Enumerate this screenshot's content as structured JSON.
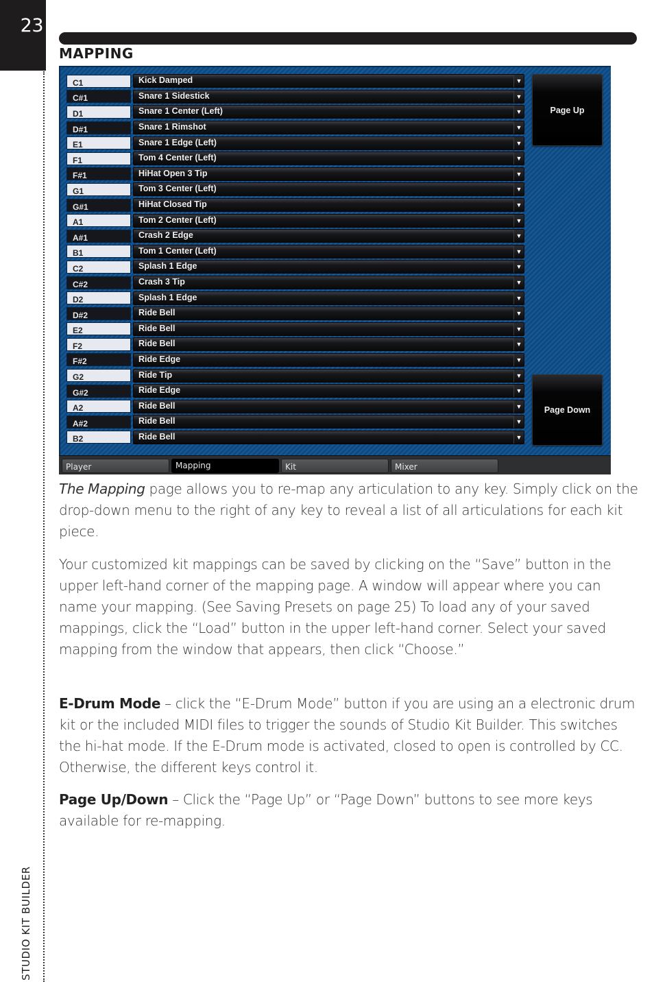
{
  "page": {
    "number": "23",
    "side_title": "STUDIO KIT BUILDER",
    "section_heading": "MAPPING"
  },
  "plugin": {
    "rows": [
      {
        "key": "C1",
        "type": "natural",
        "articulation": "Kick Damped"
      },
      {
        "key": "C#1",
        "type": "sharp",
        "articulation": "Snare 1 Sidestick"
      },
      {
        "key": "D1",
        "type": "natural",
        "articulation": "Snare 1 Center (Left)"
      },
      {
        "key": "D#1",
        "type": "sharp",
        "articulation": "Snare 1 Rimshot"
      },
      {
        "key": "E1",
        "type": "natural",
        "articulation": "Snare 1 Edge (Left)"
      },
      {
        "key": "F1",
        "type": "natural",
        "articulation": "Tom 4 Center (Left)"
      },
      {
        "key": "F#1",
        "type": "sharp",
        "articulation": "HiHat Open 3 Tip"
      },
      {
        "key": "G1",
        "type": "natural",
        "articulation": "Tom 3 Center (Left)"
      },
      {
        "key": "G#1",
        "type": "sharp",
        "articulation": "HiHat Closed Tip"
      },
      {
        "key": "A1",
        "type": "natural",
        "articulation": "Tom 2 Center (Left)"
      },
      {
        "key": "A#1",
        "type": "sharp",
        "articulation": "Crash 2 Edge"
      },
      {
        "key": "B1",
        "type": "natural",
        "articulation": "Tom 1 Center (Left)"
      },
      {
        "key": "C2",
        "type": "natural",
        "articulation": "Splash 1 Edge"
      },
      {
        "key": "C#2",
        "type": "sharp",
        "articulation": "Crash 3 Tip"
      },
      {
        "key": "D2",
        "type": "natural",
        "articulation": "Splash 1 Edge"
      },
      {
        "key": "D#2",
        "type": "sharp",
        "articulation": "Ride Bell"
      },
      {
        "key": "E2",
        "type": "natural",
        "articulation": "Ride Bell"
      },
      {
        "key": "F2",
        "type": "natural",
        "articulation": "Ride Bell"
      },
      {
        "key": "F#2",
        "type": "sharp",
        "articulation": "Ride Edge"
      },
      {
        "key": "G2",
        "type": "natural",
        "articulation": "Ride Tip"
      },
      {
        "key": "G#2",
        "type": "sharp",
        "articulation": "Ride Edge"
      },
      {
        "key": "A2",
        "type": "natural",
        "articulation": "Ride Bell"
      },
      {
        "key": "A#2",
        "type": "sharp",
        "articulation": "Ride Bell"
      },
      {
        "key": "B2",
        "type": "natural",
        "articulation": "Ride Bell"
      }
    ],
    "dropdown_icon": "triangle-down-icon",
    "page_up_label": "Page Up",
    "page_down_label": "Page Down",
    "tabs": [
      {
        "label": "Player",
        "active": false
      },
      {
        "label": "Mapping",
        "active": true
      },
      {
        "label": "Kit",
        "active": false
      },
      {
        "label": "Mixer",
        "active": false
      }
    ],
    "colors": {
      "panel_blue": "#0e4f8c",
      "natural_key": "#e6e9f0",
      "sharp_key": "#15171d"
    }
  },
  "body": {
    "p1": {
      "italic_lead": "The Mapping",
      "text": " page allows you to re-map any articulation to any key. Simply click on the drop-down menu to the right of any key to reveal a list of all articulations for each kit piece."
    },
    "p2": {
      "text": "Your customized kit mappings can be saved by clicking on the “Save” button in the upper left-hand corner of the mapping page. A window will appear where you can name your mapping. (See Saving Presets on page 25) To load any of your saved mappings, click the “Load” button in the upper left-hand corner. Select your saved mapping from the window that appears, then click “Choose.”"
    },
    "p3": {
      "bold_lead": "E-Drum Mode",
      "text": " – click the “E-Drum Mode” button if you are using an a electronic drum kit or the included MIDI files to trigger the sounds of Studio Kit Builder. This switches the hi-hat mode. If the E-Drum mode is activated, closed to open is controlled by CC. Otherwise, the different keys control it."
    },
    "p4": {
      "bold_lead": "Page Up/Down",
      "text": " – Click the “Page Up” or “Page Down” buttons to see more keys available for re-mapping."
    }
  }
}
